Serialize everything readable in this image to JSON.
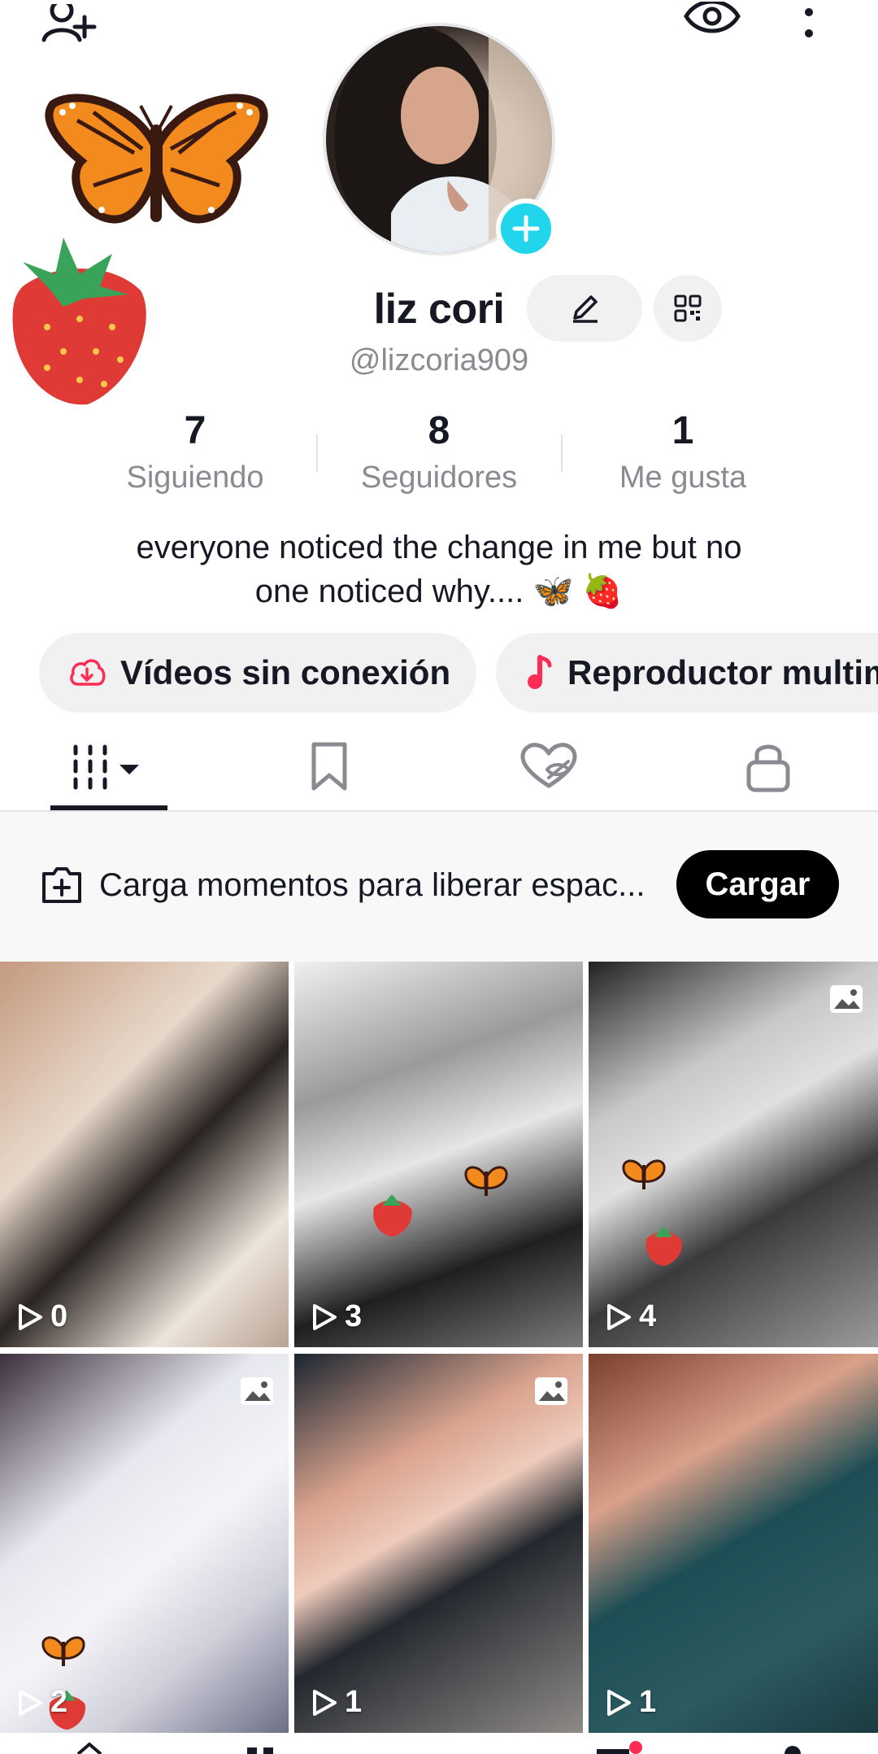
{
  "profile": {
    "display_name": "liz cori",
    "handle": "@lizcoria909",
    "bio_line1": "everyone noticed the change in me but no",
    "bio_line2": "one noticed why.... 🦋 🍓"
  },
  "stats": [
    {
      "value": "7",
      "label": "Siguiendo"
    },
    {
      "value": "8",
      "label": "Seguidores"
    },
    {
      "value": "1",
      "label": "Me gusta"
    }
  ],
  "chips": {
    "offline": "Vídeos sin conexión",
    "player": "Reproductor multimedia"
  },
  "upload": {
    "text": "Carga momentos para liberar espac...",
    "button": "Cargar"
  },
  "grid": [
    {
      "views": "0",
      "photo": false
    },
    {
      "views": "3",
      "photo": false
    },
    {
      "views": "4",
      "photo": true
    },
    {
      "views": "2",
      "photo": true
    },
    {
      "views": "1",
      "photo": true
    },
    {
      "views": "1",
      "photo": false
    }
  ],
  "colors": {
    "accent_cyan": "#20d5ec",
    "accent_red": "#fe2c55",
    "text_primary": "#161823",
    "text_secondary": "#8a8b91"
  },
  "icons": {
    "top_left": "add-friend-icon",
    "top_right_1": "eye-icon",
    "top_right_2": "more-icon",
    "tab_1": "grid-icon",
    "tab_2": "bookmark-icon",
    "tab_3": "liked-hidden-icon",
    "tab_4": "lock-icon"
  }
}
